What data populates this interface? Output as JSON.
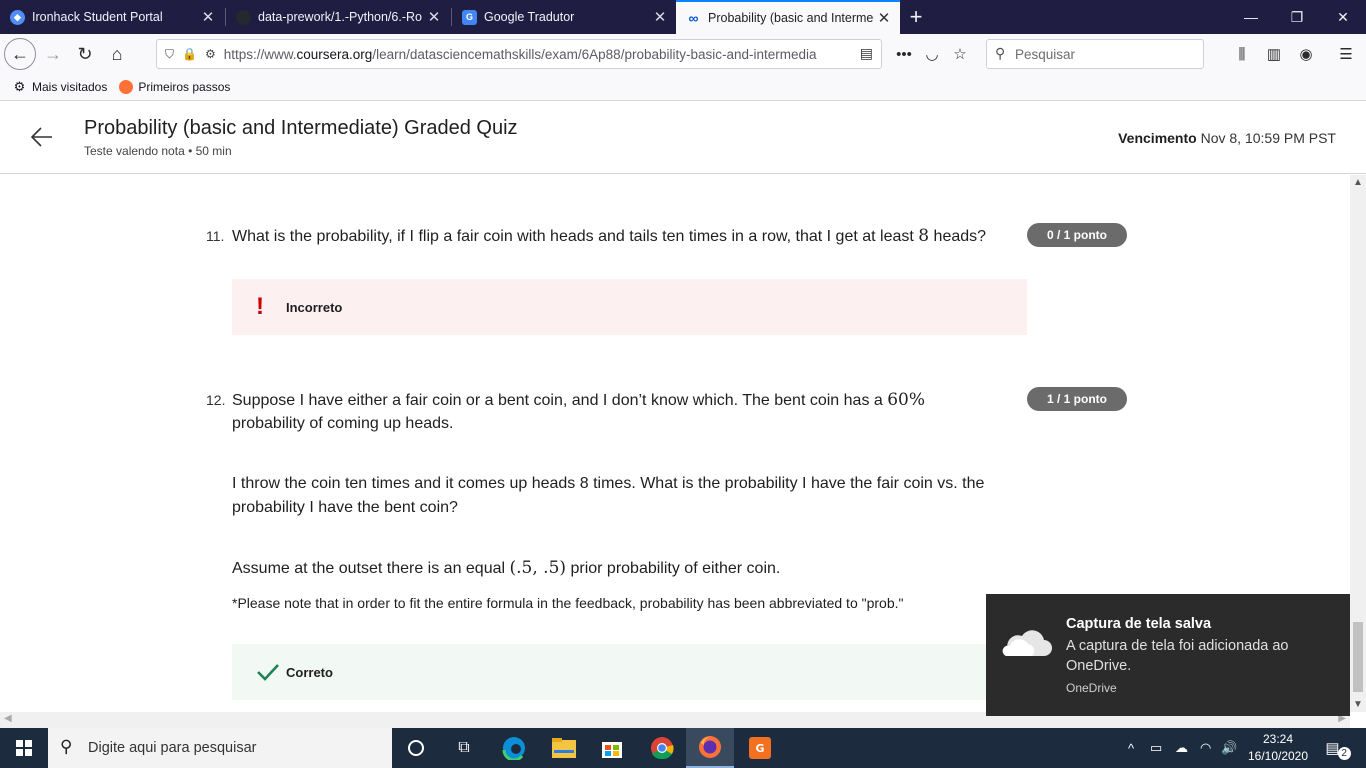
{
  "browser": {
    "tabs": [
      {
        "title": "Ironhack Student Portal",
        "icon": "shield-icon",
        "color": "#4f8ef7"
      },
      {
        "title": "data-prework/1.-Python/6.-Ro",
        "icon": "github-icon",
        "color": "#24292e"
      },
      {
        "title": "Google Tradutor",
        "icon": "google-translate-icon",
        "color": "#4285f4"
      },
      {
        "title": "Probability (basic and Intermed",
        "icon": "coursera-icon",
        "color": "#0056d2"
      }
    ],
    "url_prefix": "https://www.",
    "url_domain": "coursera.org",
    "url_path": "/learn/datasciencemathskills/exam/6Ap88/probability-basic-and-intermedia",
    "search_placeholder": "Pesquisar",
    "bookmarks": [
      {
        "label": "Mais visitados",
        "icon": "gear-icon"
      },
      {
        "label": "Primeiros passos",
        "icon": "firefox-icon"
      }
    ]
  },
  "header": {
    "title": "Probability (basic and Intermediate) Graded Quiz",
    "subtitle": "Teste valendo nota • 50 min",
    "due_label": "Vencimento",
    "due_value": "Nov 8, 10:59 PM PST"
  },
  "questions": [
    {
      "number": "11.",
      "text_before": "What is the probability, if I flip a fair coin with heads and tails ten times in a row, that I get at least ",
      "math": "8",
      "text_after": " heads?",
      "points": "0 / 1 ponto",
      "feedback": "Incorreto"
    },
    {
      "number": "12.",
      "text_line1_before": "Suppose I have either a fair coin or a bent coin, and I don’t know which. The bent coin has a ",
      "math1": "60%",
      "text_line2": "probability of coming up heads.",
      "paragraph2_line1": "I throw the coin ten times and it comes up heads 8 times. What is the probability I have the fair coin vs. the",
      "paragraph2_line2": "probability I have the bent coin?",
      "paragraph3_before": "Assume at the outset there is an equal ",
      "math2": "(.5, .5)",
      "paragraph3_after": " prior probability of either coin.",
      "note": "*Please note that in order to fit the entire formula in the feedback, probability has been abbreviated to \"prob.\"",
      "points": "1 / 1 ponto",
      "feedback": "Correto"
    }
  ],
  "toast": {
    "title": "Captura de tela salva",
    "body": "A captura de tela foi adicionada ao OneDrive.",
    "source": "OneDrive"
  },
  "taskbar": {
    "search_placeholder": "Digite aqui para pesquisar",
    "time": "23:24",
    "date": "16/10/2020",
    "notifications": "2"
  },
  "colors": {
    "tabbar_bg": "#1f1d42",
    "incorrect_bg": "#fdf0f0",
    "incorrect_mark": "#cc0000",
    "correct_bg": "#f2f8f4",
    "correct_mark": "#1f8354",
    "points_badge": "#6b6b6b"
  }
}
